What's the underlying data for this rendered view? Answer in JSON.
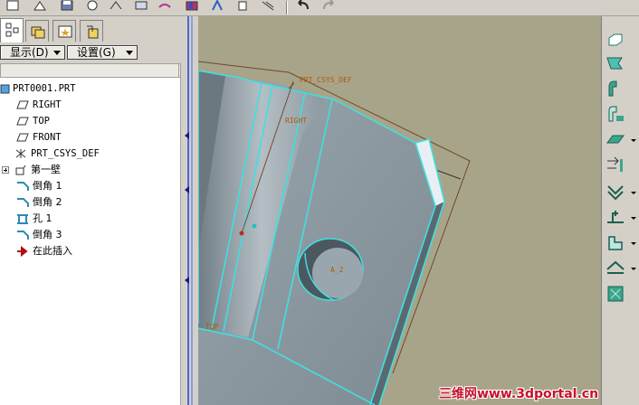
{
  "left_panel": {
    "display_menu": {
      "label": "显示(D)"
    },
    "settings_menu": {
      "label": "设置(G)"
    }
  },
  "model_tree": {
    "items": [
      {
        "label": "PRT0001.PRT",
        "icon": "part-icon"
      },
      {
        "label": "RIGHT",
        "icon": "datum-plane-icon"
      },
      {
        "label": "TOP",
        "icon": "datum-plane-icon"
      },
      {
        "label": "FRONT",
        "icon": "datum-plane-icon"
      },
      {
        "label": "PRT_CSYS_DEF",
        "icon": "csys-icon"
      },
      {
        "label": "第一壁",
        "icon": "first-wall-icon"
      },
      {
        "label": "倒角 1",
        "icon": "chamfer-icon"
      },
      {
        "label": "倒角 2",
        "icon": "chamfer-icon"
      },
      {
        "label": "孔 1",
        "icon": "hole-icon"
      },
      {
        "label": "倒角 3",
        "icon": "chamfer-icon"
      },
      {
        "label": "在此插入",
        "icon": "insert-here-arrow-icon"
      }
    ]
  },
  "viewport": {
    "labels": {
      "csys": "PRT_CSYS_DEF",
      "right": "RIGHT",
      "top": "TOP",
      "axis": "A_2"
    }
  },
  "right_toolbar": {
    "tools": [
      "sheetmetal-wall-icon",
      "flat-wall-icon",
      "flange-wall-icon",
      "extend-icon",
      "unbend-icon",
      "bend-back-icon",
      "cut-icon",
      "form-icon",
      "rip-icon",
      "corner-relief-icon",
      "bend-icon",
      "flatten-icon"
    ]
  },
  "watermark": {
    "text": "三维网www.3dportal.cn"
  },
  "colors": {
    "ui_gray": "#d4d0c8",
    "viewport_bg": "#a8a48a",
    "part_face": "#8e9aa3",
    "edge_highlight": "#3fe0e0",
    "datum_label": "#b25a00",
    "watermark": "#c8102e"
  }
}
